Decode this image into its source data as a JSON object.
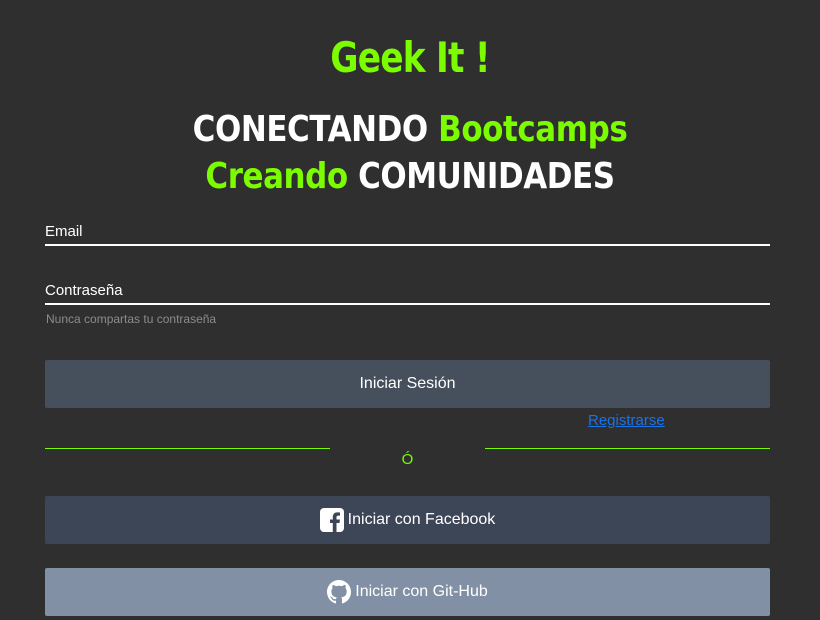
{
  "brand": {
    "title": "Geek It !"
  },
  "tagline": {
    "line1_a": "CONECTANDO",
    "line1_b": "Bootcamps",
    "line2_a": "Creando",
    "line2_b": "COMUNIDADES"
  },
  "form": {
    "email_label": "Email",
    "password_label": "Contraseña",
    "password_hint": "Nunca compartas tu contraseña",
    "login_button": "Iniciar Sesión",
    "register_link": "Registrarse",
    "or_text": "Ó"
  },
  "social": {
    "facebook_button": "Iniciar con Facebook",
    "facebook_icon": "facebook-icon",
    "github_button": "Iniciar con Git-Hub",
    "github_icon": "github-icon"
  },
  "colors": {
    "background": "#2f2f2f",
    "accent": "#7cfc00",
    "link": "#1a73e8",
    "login_button": "#464f5c",
    "facebook_button": "#3c4657",
    "github_button": "#8190a4"
  }
}
